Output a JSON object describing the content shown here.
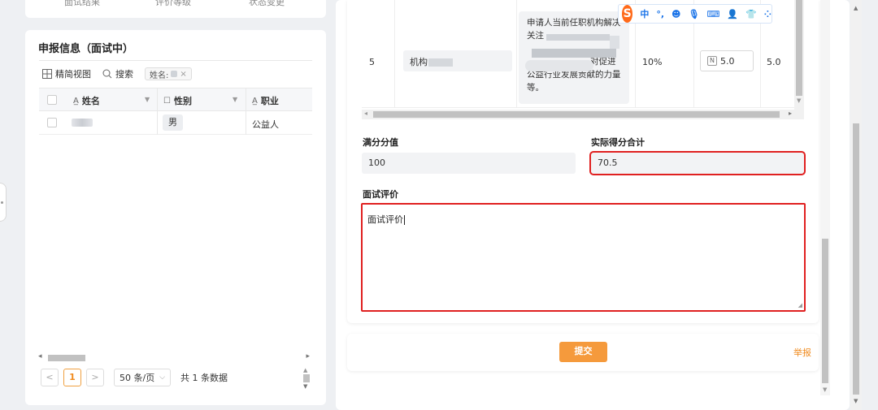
{
  "left_top": {
    "col1": "面试结果",
    "col2": "评价等级",
    "col3": "状态变更"
  },
  "declaration": {
    "title": "申报信息（面试中）",
    "toolbar": {
      "compact_view": "精简视图",
      "search": "搜索",
      "filter_chip": "姓名:"
    },
    "columns": [
      {
        "label": "姓名",
        "icon": "text-type-icon"
      },
      {
        "label": "性别",
        "icon": "select-type-icon"
      },
      {
        "label": "职业",
        "icon": "text-type-icon"
      }
    ],
    "rows": [
      {
        "gender": "男",
        "occupation": "公益人"
      }
    ],
    "pagination": {
      "prev": "<",
      "current": "1",
      "next": ">",
      "page_size": "50 条/页",
      "total": "共 1 条数据"
    }
  },
  "score_table": {
    "row_index": "5",
    "org_label": "机构",
    "desc_line1": "申请人当前任职机构解决",
    "desc_line2": "关注",
    "desc_line4": "对促进",
    "desc_line5": "公益行业发展贡献的力量",
    "desc_line6": "等。",
    "weight": "10%",
    "score_input": "5.0",
    "score_value": "5.0"
  },
  "form": {
    "full_score_label": "满分分值",
    "full_score_value": "100",
    "actual_score_label": "实际得分合计",
    "actual_score_value": "70.5",
    "comment_label": "面试评价",
    "comment_value": "面试评价"
  },
  "actions": {
    "submit": "提交",
    "report": "举报"
  },
  "ime": {
    "logo": "S",
    "mode": "中",
    "punct": "°,",
    "emoji": "☻",
    "voice": "🎙",
    "keyboard": "⌨",
    "user": "👤",
    "skin": "👕",
    "apps": "⁘"
  },
  "colors": {
    "accent": "#f59a3c",
    "highlight": "#e02020",
    "link": "#f08a1d",
    "ime_blue": "#1a73e8"
  }
}
